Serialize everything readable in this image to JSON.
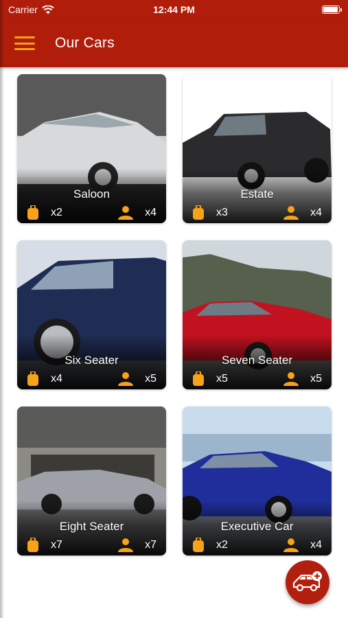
{
  "status_bar": {
    "carrier": "Carrier",
    "time": "12:44 PM"
  },
  "header": {
    "title": "Our Cars",
    "menu_icon": "hamburger-menu-icon"
  },
  "cars": [
    {
      "name": "Saloon",
      "luggage": "x2",
      "passengers": "x4",
      "color": "#c9cbcd"
    },
    {
      "name": "Estate",
      "luggage": "x3",
      "passengers": "x4",
      "color": "#2b2a2c"
    },
    {
      "name": "Six Seater",
      "luggage": "x4",
      "passengers": "x5",
      "color": "#1f2d55"
    },
    {
      "name": "Seven Seater",
      "luggage": "x5",
      "passengers": "x5",
      "color": "#c3121f"
    },
    {
      "name": "Eight Seater",
      "luggage": "x7",
      "passengers": "x7",
      "color": "#9ea2a8"
    },
    {
      "name": "Executive Car",
      "luggage": "x2",
      "passengers": "x4",
      "color": "#1f2e9a"
    }
  ],
  "colors": {
    "primary": "#b01e0b",
    "accent": "#f7a218",
    "card_text": "#ffffff"
  },
  "fab": {
    "icon": "add-car-icon"
  }
}
